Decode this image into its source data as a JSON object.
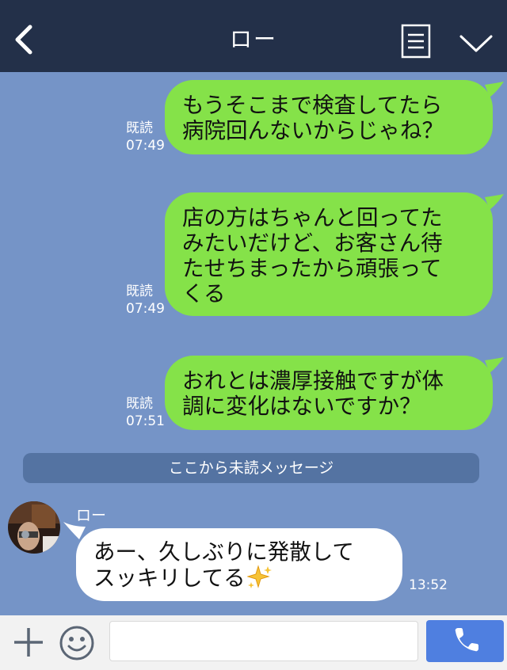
{
  "header": {
    "title": "ロー",
    "back_icon": "chevron-left-icon",
    "notes_icon": "notes-icon",
    "menu_icon": "chevron-down-icon",
    "background": "#233049"
  },
  "messages_out": [
    {
      "lines": [
        "もうそこまで検査してたら",
        "病院回んないからじゃね？"
      ],
      "read_label": "既読",
      "time": "07:49"
    },
    {
      "lines": [
        "店の方はちゃんと回ってた",
        "みたいだけど、お客さん待",
        "たせちまったから頑張って",
        "くる"
      ],
      "read_label": "既読",
      "time": "07:49"
    },
    {
      "lines": [
        "おれとは濃厚接触ですが体",
        "調に変化はないですか？"
      ],
      "read_label": "既読",
      "time": "07:51"
    }
  ],
  "unread_divider": "ここから未読メッセージ",
  "message_in": {
    "sender": "ロー",
    "lines": [
      "あー、久しぶりに発散して",
      "スッキリしてる"
    ],
    "emoji": "sparkles-icon",
    "time": "13:52"
  },
  "input_bar": {
    "plus_icon": "plus-icon",
    "emoji_icon": "smiley-icon",
    "input_value": "",
    "input_placeholder": "",
    "call_icon": "phone-icon"
  },
  "colors": {
    "chat_background": "#7594c7",
    "outgoing_bubble": "#85e249",
    "incoming_bubble": "#ffffff",
    "unread_bar": "#5473a2",
    "call_button": "#4f7fe0"
  }
}
